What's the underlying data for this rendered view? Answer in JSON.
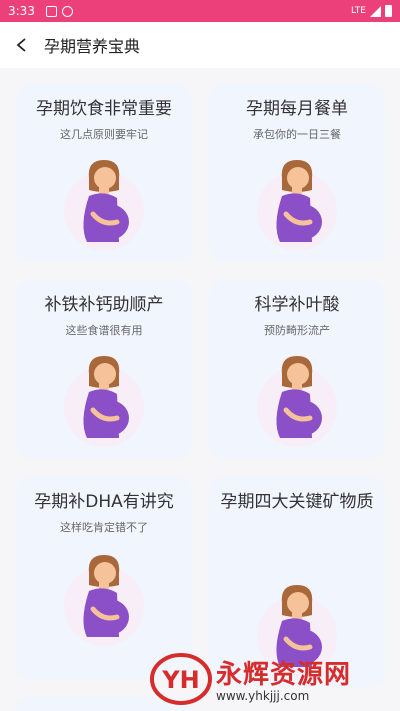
{
  "status_bar": {
    "time": "3:33",
    "network": "LTE"
  },
  "header": {
    "title": "孕期营养宝典"
  },
  "cards": [
    {
      "title": "孕期饮食非常重要",
      "subtitle": "这几点原则要牢记"
    },
    {
      "title": "孕期每月餐单",
      "subtitle": "承包你的一日三餐"
    },
    {
      "title": "补铁补钙助顺产",
      "subtitle": "这些食谱很有用"
    },
    {
      "title": "科学补叶酸",
      "subtitle": "预防畸形流产"
    },
    {
      "title": "孕期补DHA有讲究",
      "subtitle": "这样吃肯定错不了"
    },
    {
      "title": "孕期四大关键矿物质",
      "subtitle": ""
    }
  ],
  "watermark": {
    "logo_text": "YH",
    "name": "永辉资源网",
    "url": "www.yhkjjj.com"
  },
  "colors": {
    "status_bar": "#ec407a",
    "card_bg": "#f1f5fe",
    "dress": "#8b4fc7",
    "hair": "#a8683a",
    "skin": "#f5c29a"
  },
  "icons": {
    "back": "chevron-left-icon",
    "illustration": "pregnant-woman-icon"
  }
}
